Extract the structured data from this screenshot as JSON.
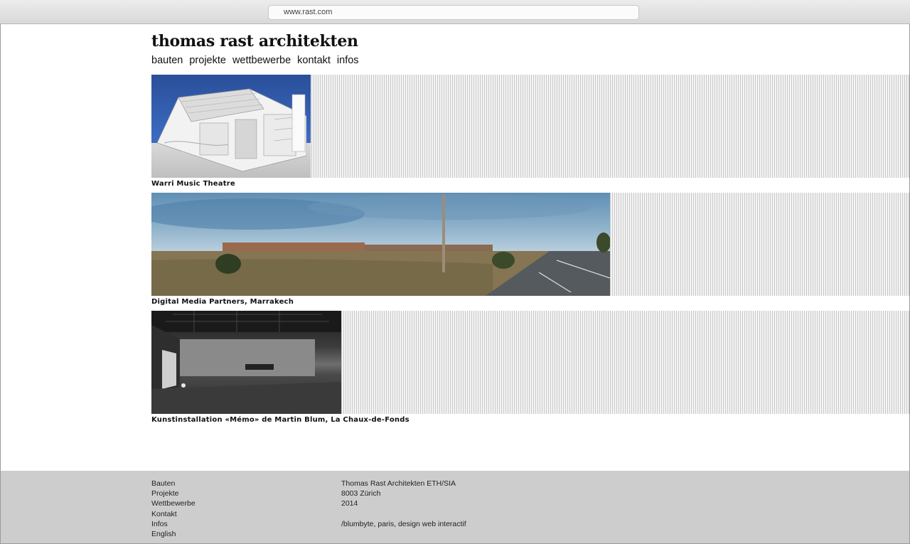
{
  "browser": {
    "url": "www.rast.com"
  },
  "site": {
    "title": "thomas rast architekten",
    "nav": [
      "bauten",
      "projekte",
      "wettbewerbe",
      "kontakt",
      "infos"
    ]
  },
  "projects": [
    {
      "caption": "Warri Music Theatre"
    },
    {
      "caption": "Digital Media Partners, Marrakech"
    },
    {
      "caption": "Kunstinstallation «Mémo» de Martin Blum, La Chaux-de-Fonds"
    }
  ],
  "footer": {
    "links": [
      "Bauten",
      "Projekte",
      "Wettbewerbe",
      "Kontakt",
      "Infos",
      "English"
    ],
    "info": {
      "firm": "Thomas Rast Architekten ETH/SIA",
      "city": "8003 Zürich",
      "year": "2014",
      "credit": "/blumbyte, paris, design web interactif"
    }
  },
  "colors": {
    "footer_bg": "#cdcdcd",
    "strip_lines": "#c9c9c9"
  }
}
